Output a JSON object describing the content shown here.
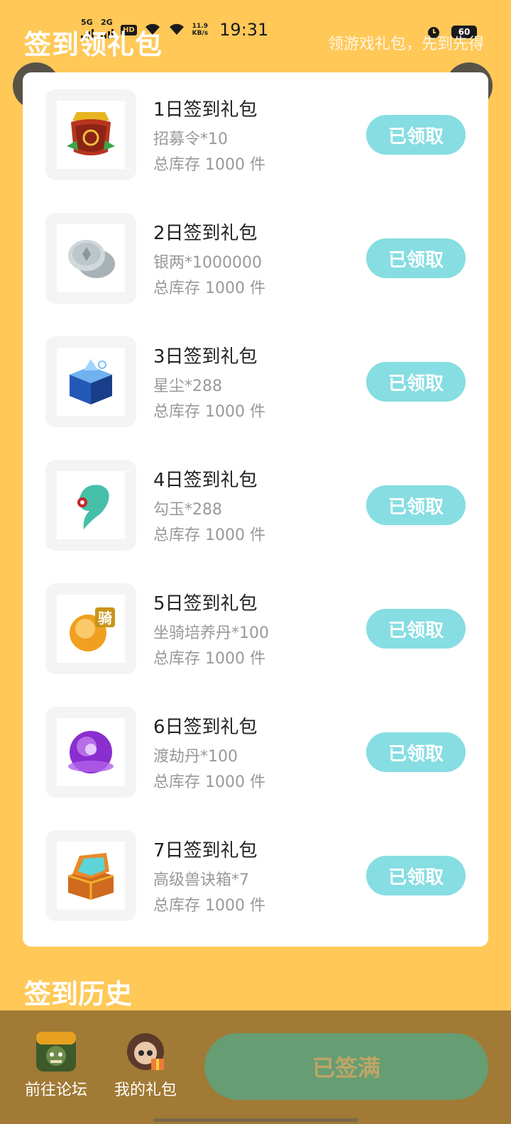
{
  "status_bar": {
    "net1": "5G",
    "net2": "2G",
    "hd": "HD",
    "speed_value": "11.9",
    "speed_unit": "KB/s",
    "time": "19:31",
    "battery": "60"
  },
  "header": {
    "title": "签到领礼包",
    "subtitle": "领游戏礼包，先到先得"
  },
  "gifts": [
    {
      "title": "1日签到礼包",
      "item": "招募令*10",
      "stock": "总库存 1000 件",
      "button": "已领取",
      "icon": "recruit-token-icon"
    },
    {
      "title": "2日签到礼包",
      "item": "银两*1000000",
      "stock": "总库存 1000 件",
      "button": "已领取",
      "icon": "silver-coin-icon"
    },
    {
      "title": "3日签到礼包",
      "item": "星尘*288",
      "stock": "总库存 1000 件",
      "button": "已领取",
      "icon": "star-dust-chest-icon"
    },
    {
      "title": "4日签到礼包",
      "item": "勾玉*288",
      "stock": "总库存 1000 件",
      "button": "已领取",
      "icon": "jade-icon"
    },
    {
      "title": "5日签到礼包",
      "item": "坐骑培养丹*100",
      "stock": "总库存 1000 件",
      "button": "已领取",
      "icon": "mount-pill-icon",
      "badge": "骑"
    },
    {
      "title": "6日签到礼包",
      "item": "渡劫丹*100",
      "stock": "总库存 1000 件",
      "button": "已领取",
      "icon": "purple-pill-icon"
    },
    {
      "title": "7日签到礼包",
      "item": "高级兽诀箱*7",
      "stock": "总库存 1000 件",
      "button": "已领取",
      "icon": "treasure-chest-icon"
    }
  ],
  "history": {
    "title": "签到历史"
  },
  "bottom": {
    "forum_label": "前往论坛",
    "gifts_label": "我的礼包",
    "signed_label": "已签满"
  },
  "colors": {
    "background": "#FFC857",
    "claim_button": "#86DDE2",
    "bottom_bar": "#A17A35",
    "signed_button": "#679D72"
  }
}
